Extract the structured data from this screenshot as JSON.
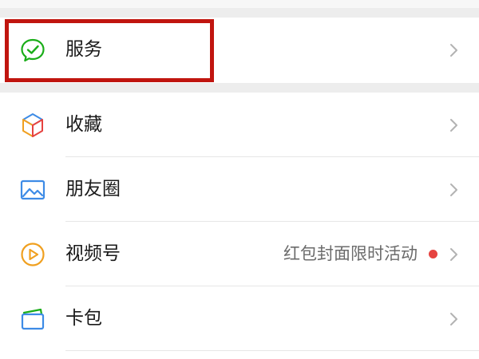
{
  "service": {
    "label": "服务",
    "icon": "service-chat-check-icon"
  },
  "items": [
    {
      "label": "收藏",
      "icon": "favorites-cube-icon"
    },
    {
      "label": "朋友圈",
      "icon": "moments-picture-icon"
    },
    {
      "label": "视频号",
      "icon": "channels-play-icon",
      "extra": "红包封面限时活动",
      "badge": true
    },
    {
      "label": "卡包",
      "icon": "card-wallet-icon"
    }
  ],
  "colors": {
    "background": "#ededed",
    "card": "#ffffff",
    "highlight_border": "#c0150f",
    "badge_dot": "#e64340",
    "service_icon": "#1aad19",
    "chevron": "#b2b2b2"
  }
}
